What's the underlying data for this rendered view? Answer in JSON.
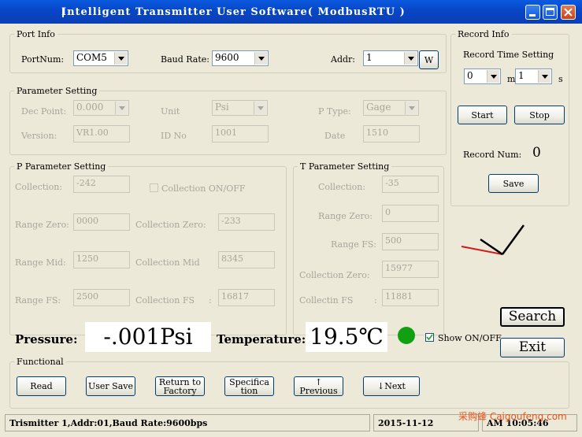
{
  "window": {
    "title": "Intelligent Transmitter User Software( ModbusRTU )"
  },
  "port_info": {
    "group_label": "Port Info",
    "portnum_label": "PortNum:",
    "portnum_value": "COM5",
    "baud_label": "Baud Rate:",
    "baud_value": "9600",
    "addr_label": "Addr:",
    "addr_value": "1",
    "w_button": "W"
  },
  "record_info": {
    "group_label": "Record Info",
    "time_setting_label": "Record Time Setting",
    "minutes_value": "0",
    "m_unit": "m",
    "seconds_value": "1",
    "s_unit": "s",
    "start_button": "Start",
    "stop_button": "Stop",
    "record_num_label": "Record Num:",
    "record_num_value": "0",
    "save_button": "Save"
  },
  "parameter_setting": {
    "group_label": "Parameter Setting",
    "dec_point_label": "Dec Point:",
    "dec_point_value": "0.000",
    "unit_label": "Unit",
    "unit_value": "Psi",
    "ptype_label": "P Type:",
    "ptype_value": "Gage",
    "version_label": "Version:",
    "version_value": "VR1.00",
    "idno_label": "ID No",
    "idno_value": "1001",
    "date_label": "Date",
    "date_value": "1510"
  },
  "p_parameter": {
    "group_label": "P Parameter Setting",
    "collection_label": "Collection:",
    "collection_value": "-242",
    "collection_onoff_label": "Collection ON/OFF",
    "range_zero_label": "Range Zero:",
    "range_zero_value": "0000",
    "collection_zero_label": "Collection Zero:",
    "collection_zero_value": "-233",
    "range_mid_label": "Range Mid:",
    "range_mid_value": "1250",
    "collection_mid_label": "Collection Mid",
    "collection_mid_value": "8345",
    "range_fs_label": "Range FS:",
    "range_fs_value": "2500",
    "collection_fs_label": "Collection FS",
    "collection_fs_colon": ":",
    "collection_fs_value": "16817"
  },
  "t_parameter": {
    "group_label": "T Parameter Setting",
    "collection_label": "Collection:",
    "collection_value": "-35",
    "range_zero_label": "Range Zero:",
    "range_zero_value": "0",
    "range_fs_label": "Range FS:",
    "range_fs_value": "500",
    "collection_zero_label": "Collection Zero:",
    "collection_zero_value": "15977",
    "collectin_fs_label": "Collectin FS",
    "collectin_fs_colon": ":",
    "collectin_fs_value": "11881"
  },
  "readout": {
    "pressure_label": "Pressure:",
    "pressure_value": "-.001Psi",
    "temperature_label": "Temperature:",
    "temperature_value": "19.5℃",
    "indicator_color": "#11a011",
    "show_onoff_label": "Show ON/OFF"
  },
  "side_buttons": {
    "search": "Search",
    "exit": "Exit"
  },
  "functional": {
    "group_label": "Functional",
    "read": "Read",
    "user_save": "User Save",
    "return_factory_1": "Return to",
    "return_factory_2": "Factory",
    "specification_1": "Specifica",
    "specification_2": "tion",
    "previous_arrow": "↑",
    "previous_label": "Previous",
    "next_label": "↓Next"
  },
  "status_bar": {
    "info": "Trismitter 1,Addr:01,Baud Rate:9600bps",
    "date": "2015-11-12",
    "time": "AM 10:05:46",
    "watermark": "采购蜂 Caigoufeng.com"
  },
  "colors": {
    "title_bar": "#0a4fd4",
    "background": "#ece9d8",
    "clock_hand_red": "#d21a1a",
    "clock_hand_black": "#000000"
  }
}
